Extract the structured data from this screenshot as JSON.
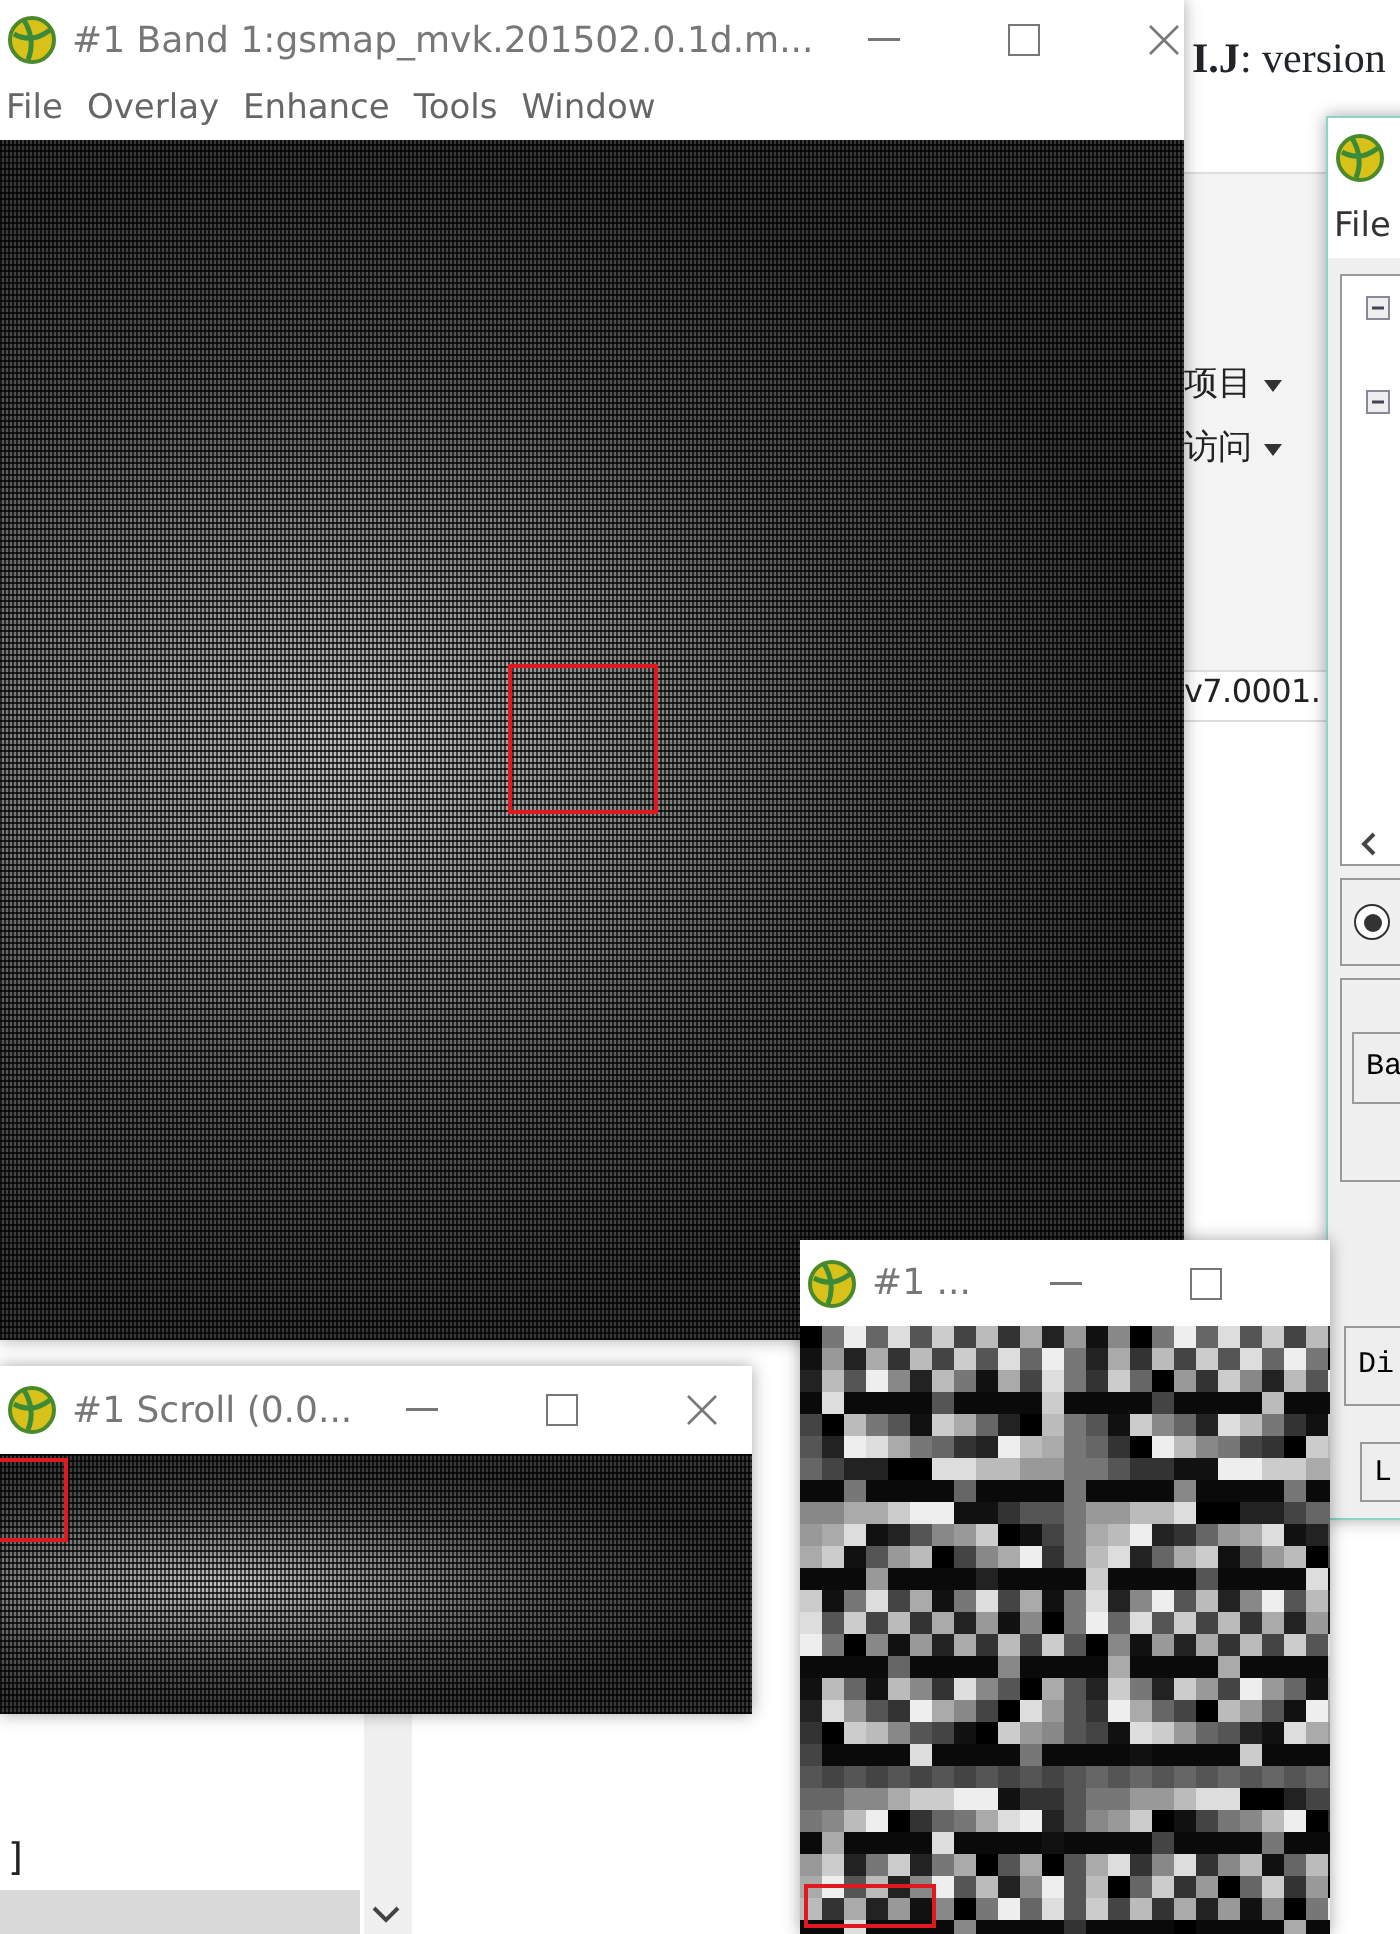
{
  "background_page": {
    "heading": "**I.J**: version",
    "menu_items": [
      {
        "label": "项目"
      },
      {
        "label": "访问"
      }
    ],
    "file_text": "v7.0001.",
    "bracket_text": "]"
  },
  "image_window": {
    "title": "#1 Band 1:gsmap_mvk.201502.0.1d.m...",
    "menu": [
      "File",
      "Overlay",
      "Enhance",
      "Tools",
      "Window"
    ]
  },
  "layer_manager": {
    "menu": [
      "File"
    ],
    "tree": [
      {
        "expanded": true
      },
      {
        "expanded": true
      }
    ],
    "radio": {
      "selected": true
    },
    "buttons": [
      "Ba",
      "Di",
      "L"
    ]
  },
  "zoom_window": {
    "title": "#1 ..."
  },
  "scroll_window": {
    "title": "#1 Scroll (0.0..."
  }
}
